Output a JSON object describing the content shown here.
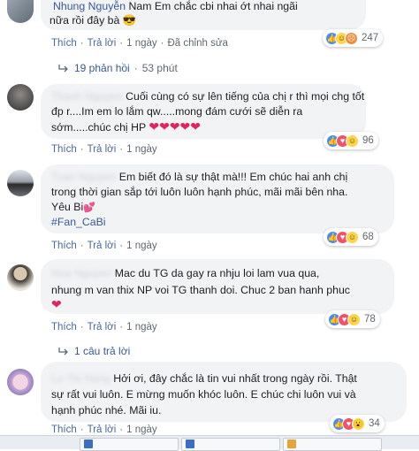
{
  "comments": [
    {
      "author": "Nhung Nguyễn",
      "text_line1": "Nam Em chắc cbi nhai ớt nhai ngãi",
      "text_line2": "nữa rồi đây bà 😎",
      "actions": {
        "like": "Thích",
        "reply": "Trả lời",
        "time": "1 ngày",
        "edited": "Đã chỉnh sửa"
      },
      "reaction_count": "247",
      "replies_text": "19 phản hồi",
      "replies_time": "53 phút"
    },
    {
      "author": "Thanh Nguyen",
      "text_line1": "Cuối cùng có sự lên tiếng của chị r thì mọi chg tốt",
      "text_line2": "đp r....Im em lo lắm qw.....mong đám cưới sẽ diễn ra",
      "text_line3": "sớm.....chúc chị HP",
      "hearts": "❤❤❤❤❤",
      "actions": {
        "like": "Thích",
        "reply": "Trả lời",
        "time": "1 ngày"
      },
      "reaction_count": "96"
    },
    {
      "author": "Tuan Nguyen",
      "text_line1": "Em biết đó là sự thật mà!!! Em chúc hai anh chị",
      "text_line2": "trong thời gian sắp tới luôn luôn hạnh phúc, mãi mãi bên nha.",
      "text_line3": "Yêu Bi",
      "small_heart": "💕",
      "hashtag": "#Fan_CaBi",
      "actions": {
        "like": "Thích",
        "reply": "Trả lời",
        "time": "1 ngày"
      },
      "reaction_count": "68"
    },
    {
      "author": "Hoa Nguyen",
      "text_line1": "Mac du TG da gay ra nhju loi lam vua qua,",
      "text_line2": "nhung m van thix NP voi TG thanh doi. Chuc 2 ban hanh phuc",
      "heart": "❤",
      "actions": {
        "like": "Thích",
        "reply": "Trả lời",
        "time": "1 ngày"
      },
      "reaction_count": "78",
      "replies_text": "1 câu trả lời"
    },
    {
      "author": "Le Thi Hang",
      "text_line1": "Hởi ơi, đây chắc là tin vui nhất trong ngày rồi. Thật",
      "text_line2": "sự rất vui luôn. E mừng muốn khóc luôn. E chúc chi luôn vui và",
      "text_line3": "hạnh phúc nhé. Mãi iu.",
      "actions": {
        "like": "Thích",
        "reply": "Trả lời",
        "time": "1 ngày"
      },
      "reaction_count": "34"
    }
  ]
}
